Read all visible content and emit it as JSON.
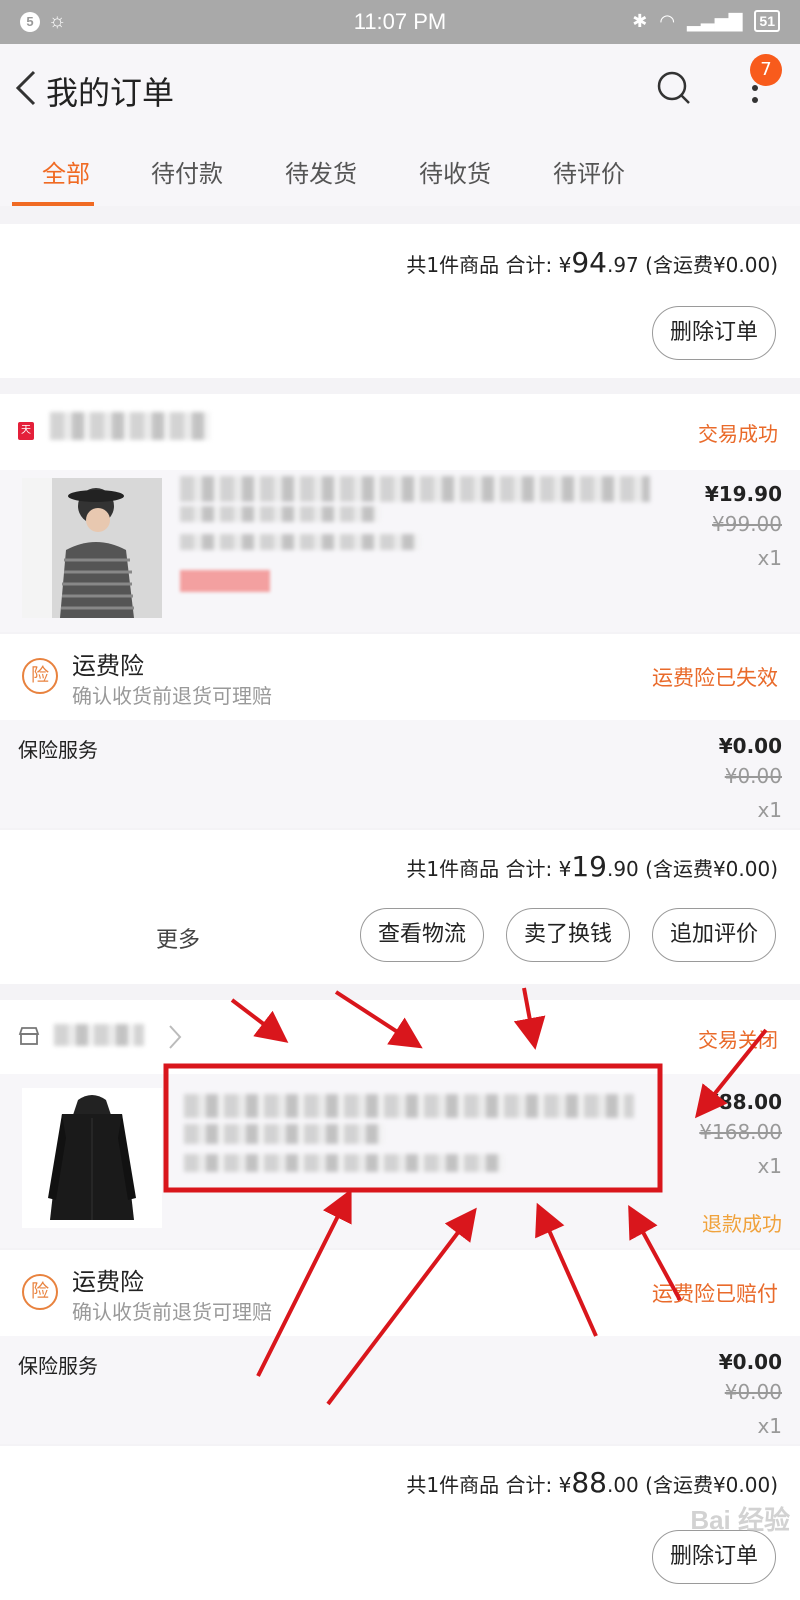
{
  "statusbar": {
    "notif_count": "5",
    "time": "11:07 PM",
    "battery": "51"
  },
  "header": {
    "title": "我的订单",
    "badge": "7"
  },
  "tabs": [
    {
      "label": "全部",
      "active": true
    },
    {
      "label": "待付款"
    },
    {
      "label": "待发货"
    },
    {
      "label": "待收货"
    },
    {
      "label": "待评价"
    }
  ],
  "order0": {
    "summary_prefix": "共1件商品  合计: ¥",
    "total_int": "94",
    "total_dec": ".97",
    "shipping": " (含运费¥0.00)",
    "delete_button": "删除订单"
  },
  "order1": {
    "status": "交易成功",
    "item": {
      "price": "¥19.90",
      "old_price": "¥99.00",
      "qty": "x1"
    },
    "insurance": {
      "icon": "险",
      "title": "运费险",
      "subtitle": "确认收货前退货可理赔",
      "status": "运费险已失效"
    },
    "service": {
      "label": "保险服务",
      "price": "¥0.00",
      "old_price": "¥0.00",
      "qty": "x1"
    },
    "summary_prefix": "共1件商品  合计: ¥",
    "total_int": "19",
    "total_dec": ".90",
    "shipping": " (含运费¥0.00)",
    "actions": {
      "more": "更多",
      "logistics": "查看物流",
      "sell": "卖了换钱",
      "review": "追加评价"
    }
  },
  "order2": {
    "status": "交易关闭",
    "item": {
      "price": "¥88.00",
      "old_price": "¥168.00",
      "qty": "x1",
      "refund": "退款成功"
    },
    "insurance": {
      "icon": "险",
      "title": "运费险",
      "subtitle": "确认收货前退货可理赔",
      "status": "运费险已赔付"
    },
    "service": {
      "label": "保险服务",
      "price": "¥0.00",
      "old_price": "¥0.00",
      "qty": "x1"
    },
    "summary_prefix": "共1件商品  合计: ¥",
    "total_int": "88",
    "total_dec": ".00",
    "shipping": " (含运费¥0.00)",
    "delete_button": "删除订单"
  },
  "colors": {
    "accent": "#f06a23",
    "status_orange": "#e96a2a",
    "refund_yellow": "#f0a23c",
    "annotation_red": "#d9161c"
  },
  "icons": [
    "back-icon",
    "search-icon",
    "more-vert-icon",
    "tmall-icon",
    "store-icon",
    "chevron-right-icon",
    "insurance-icon"
  ],
  "watermark": "Bai 经验"
}
